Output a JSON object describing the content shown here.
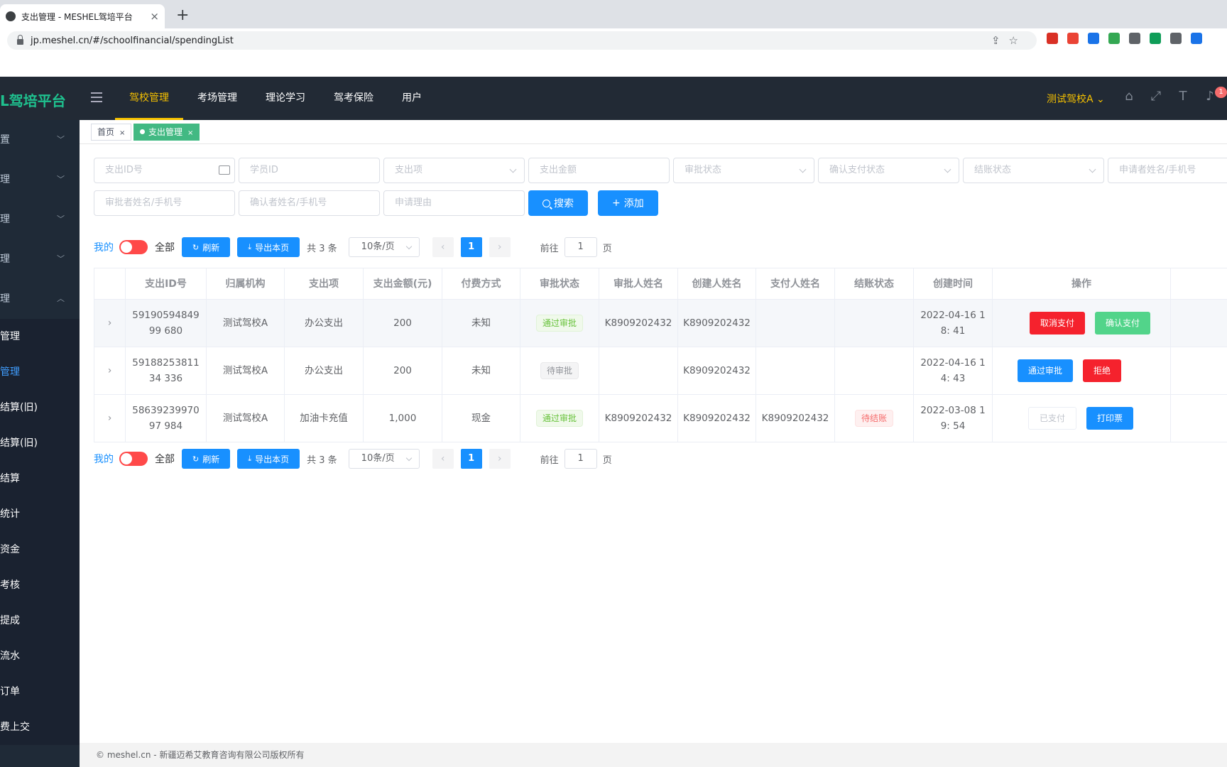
{
  "browser": {
    "tab_title": "支出管理 - MESHEL驾培平台",
    "tab_close": "×",
    "new_tab": "+",
    "url": "jp.meshel.cn/#/schoolfinancial/spendingList",
    "ext_colors": [
      "#d93025",
      "#ea4335",
      "#1a73e8",
      "#34a853",
      "#5f6368",
      "#0f9d58",
      "#5f6368",
      "#1a73e8"
    ]
  },
  "header": {
    "logo": "L驾培平台",
    "nav": [
      "驾校管理",
      "考场管理",
      "理论学习",
      "驾考保险",
      "用户"
    ],
    "school": "测试驾校A ⌄",
    "notification_count": "1"
  },
  "sidebar": {
    "groups": [
      "置",
      "理",
      "理",
      "理",
      "理"
    ],
    "subitems": [
      "管理",
      "管理",
      "结算(旧)",
      "结算(旧)",
      "结算",
      "统计",
      "资金",
      "考核",
      "提成",
      "流水",
      "订单",
      "费上交"
    ]
  },
  "tags": {
    "home": "首页",
    "current": "支出管理",
    "close": "×"
  },
  "filters": {
    "row1": [
      "支出ID号",
      "学员ID",
      "支出项",
      "支出金额",
      "审批状态",
      "确认支付状态",
      "结账状态",
      "申请者姓名/手机号"
    ],
    "row2": [
      "审批者姓名/手机号",
      "确认者姓名/手机号",
      "申请理由"
    ],
    "search": "搜索",
    "add": "添加"
  },
  "pager": {
    "mine": "我的",
    "all": "全部",
    "refresh": "刷新",
    "export": "导出本页",
    "total": "共 3 条",
    "page_size": "10条/页",
    "page": "1",
    "goto_prefix": "前往",
    "goto_value": "1",
    "goto_suffix": "页"
  },
  "table": {
    "columns": [
      "",
      "支出ID号",
      "归属机构",
      "支出项",
      "支出金额(元)",
      "付费方式",
      "审批状态",
      "审批人姓名",
      "创建人姓名",
      "支付人姓名",
      "结账状态",
      "创建时间",
      "操作"
    ],
    "rows": [
      {
        "expand": "›",
        "id": "5919059484999 680",
        "org": "测试驾校A",
        "item": "办公支出",
        "amount": "200",
        "pay": "未知",
        "approve": "通过审批",
        "approver": "K8909202432",
        "creator": "K8909202432",
        "payer": "",
        "settle": "",
        "time": "2022-04-16 18: 41",
        "op1": "取消支付",
        "op2": "确认支付"
      },
      {
        "expand": "›",
        "id": "5918825381134 336",
        "org": "测试驾校A",
        "item": "办公支出",
        "amount": "200",
        "pay": "未知",
        "approve": "待审批",
        "approver": "",
        "creator": "K8909202432",
        "payer": "",
        "settle": "",
        "time": "2022-04-16 14: 43",
        "op1": "通过审批",
        "op2": "拒绝"
      },
      {
        "expand": "›",
        "id": "5863923997097 984",
        "org": "测试驾校A",
        "item": "加油卡充值",
        "amount": "1,000",
        "pay": "现金",
        "approve": "通过审批",
        "approver": "K8909202432",
        "creator": "K8909202432",
        "payer": "K8909202432",
        "settle": "待结账",
        "time": "2022-03-08 19: 54",
        "op1": "已支付",
        "op2": "打印票"
      }
    ]
  },
  "footer": "© meshel.cn - 新疆迈希艾教育咨询有限公司版权所有"
}
